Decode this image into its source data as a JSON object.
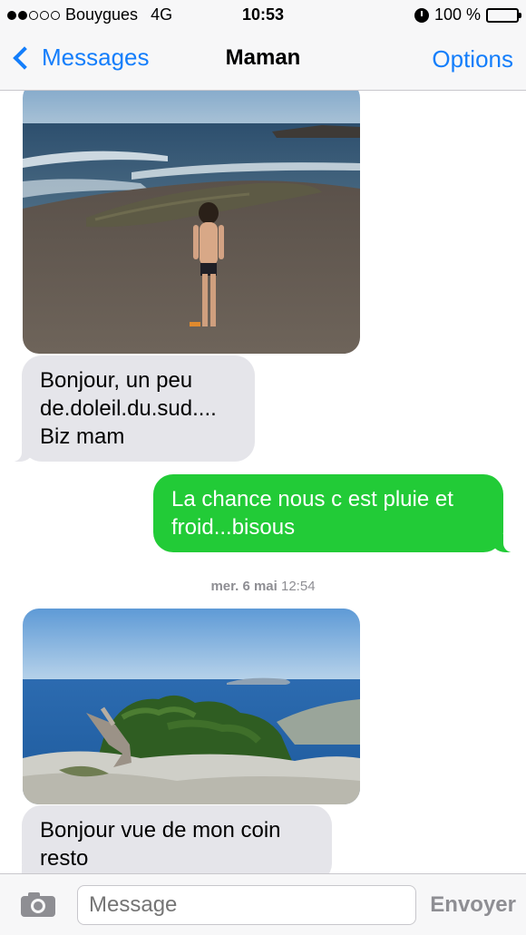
{
  "status_bar": {
    "carrier": "Bouygues",
    "network": "4G",
    "time": "10:53",
    "battery": "100 %",
    "signal_bars_filled": 2,
    "signal_bars_total": 5
  },
  "nav": {
    "back_label": "Messages",
    "title": "Maman",
    "options_label": "Options"
  },
  "messages": [
    {
      "type": "photo",
      "direction": "received",
      "subject": "beach-photo"
    },
    {
      "type": "text",
      "direction": "received",
      "lines": [
        "Bonjour,  un peu",
        "de.doleil.du.sud....",
        "Biz mam"
      ]
    },
    {
      "type": "text",
      "direction": "sent",
      "lines": [
        "La chance nous c est pluie et",
        "froid...bisous"
      ]
    },
    {
      "type": "timestamp",
      "day": "mer. 6 mai",
      "time": "12:54"
    },
    {
      "type": "photo",
      "direction": "received",
      "subject": "coastal-view-photo"
    },
    {
      "type": "text",
      "direction": "received",
      "lines": [
        "Bonjour vue de mon coin",
        "resto"
      ]
    }
  ],
  "input": {
    "placeholder": "Message",
    "send_label": "Envoyer"
  },
  "colors": {
    "accent": "#147efb",
    "sent_bubble": "#22cb37",
    "received_bubble": "#e5e5ea"
  }
}
